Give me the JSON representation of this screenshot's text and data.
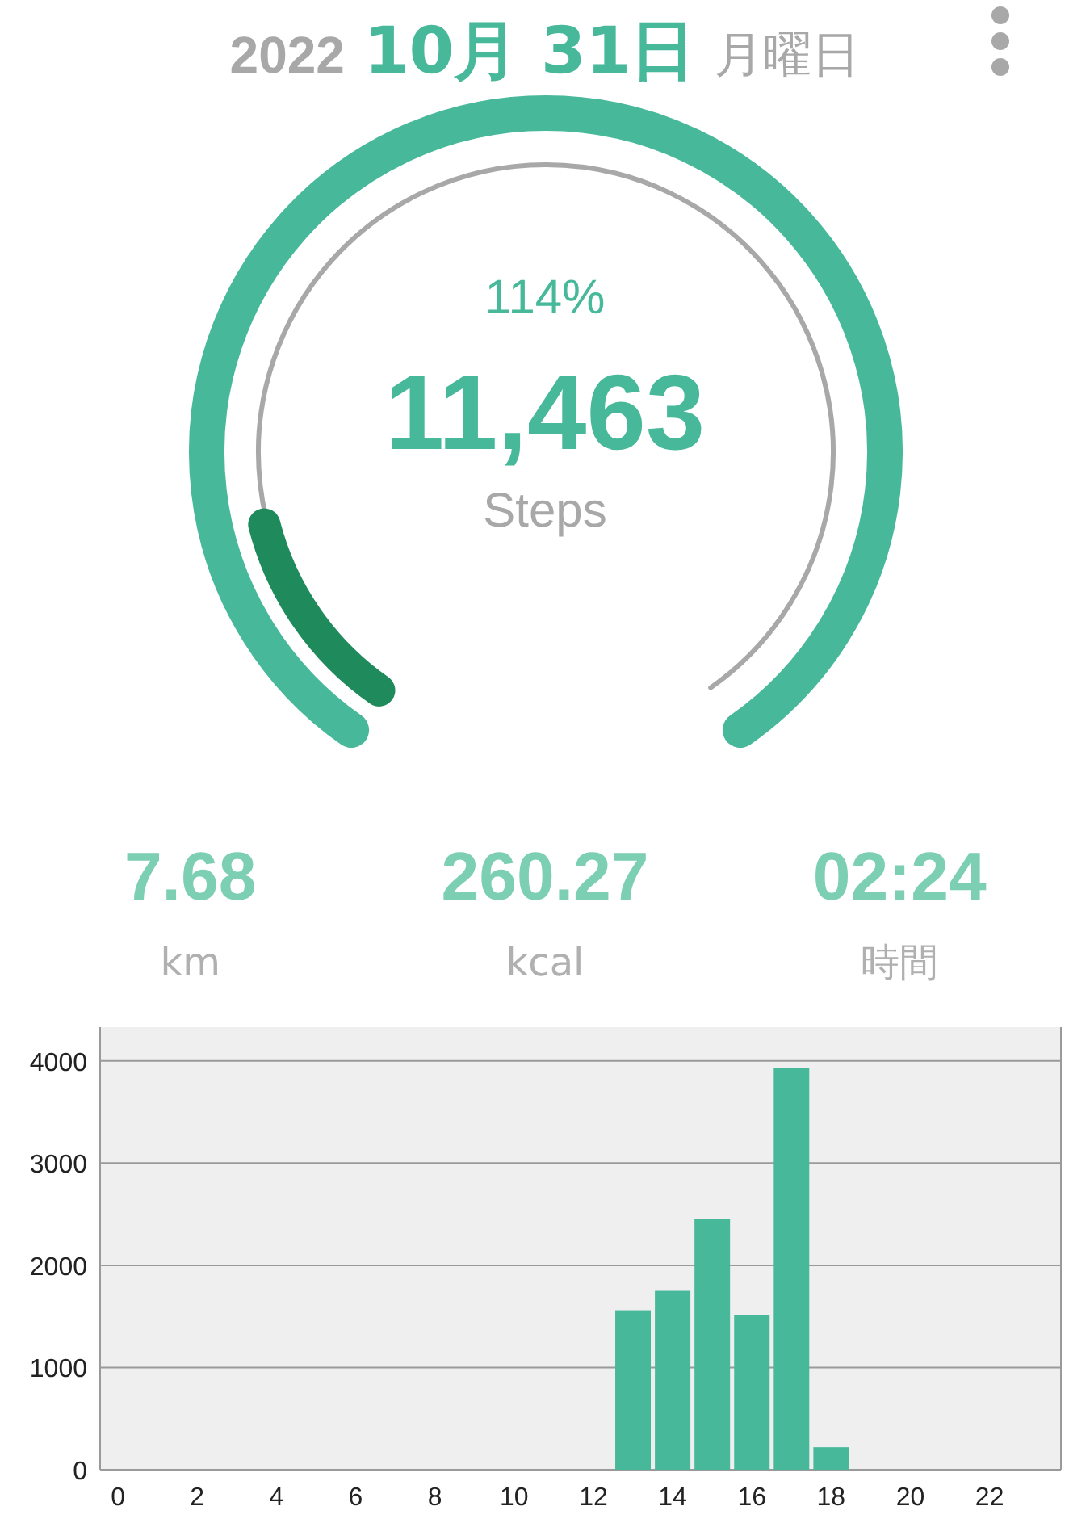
{
  "header": {
    "year": "2022",
    "date": "10月 31日",
    "weekday": "月曜日"
  },
  "gauge": {
    "level": 1,
    "overflow": {
      "level": 0.14
    },
    "percent": "114%",
    "steps": "11,463",
    "unit": "Steps"
  },
  "stats": [
    {
      "value": "7.68",
      "label": "km"
    },
    {
      "value": "260.27",
      "label": "kcal"
    },
    {
      "value": "02:24",
      "label": "時間"
    }
  ],
  "chart": {
    "chart_data": {
      "type": "bar",
      "x": [
        0,
        1,
        2,
        3,
        4,
        5,
        6,
        7,
        8,
        9,
        10,
        11,
        12,
        13,
        14,
        15,
        16,
        17,
        18,
        19,
        20,
        21,
        22,
        23
      ],
      "grid": true,
      "values": [
        0,
        0,
        0,
        0,
        0,
        0,
        0,
        0,
        0,
        0,
        0,
        0,
        0,
        1560,
        1750,
        2450,
        1510,
        3930,
        220,
        0,
        0,
        0,
        0,
        0
      ],
      "xlim": [
        -0.45,
        23.8
      ],
      "ylim": [
        0,
        4330
      ],
      "yticks": [
        0,
        1000,
        2000,
        3000,
        4000
      ],
      "xticks": [
        0,
        2,
        4,
        6,
        8,
        10,
        12,
        14,
        16,
        18,
        20,
        22
      ]
    }
  }
}
